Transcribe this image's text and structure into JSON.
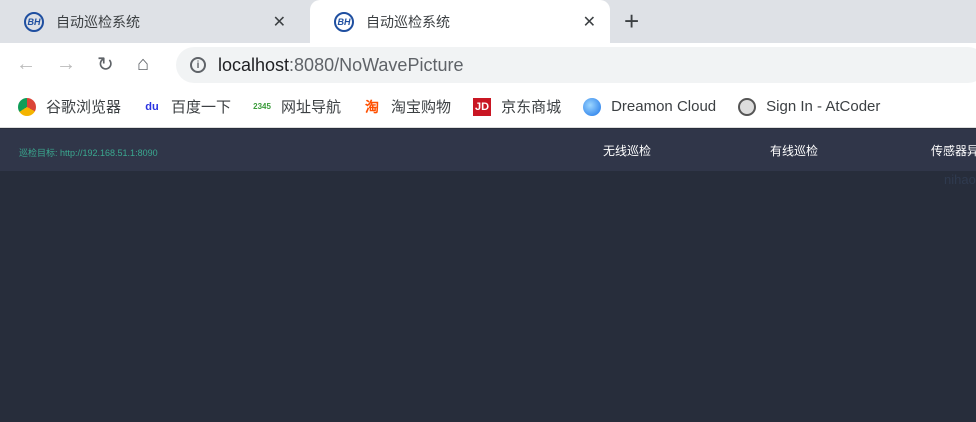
{
  "tabs": [
    {
      "title": "自动巡检系统",
      "close": "✕"
    },
    {
      "title": "自动巡检系统",
      "close": "✕"
    }
  ],
  "new_tab": "+",
  "address": {
    "host": "localhost",
    "path": ":8080/NoWavePicture"
  },
  "bookmarks": [
    {
      "label": "谷歌浏览器",
      "icon": "chrome-icon"
    },
    {
      "label": "百度一下",
      "icon": "baidu-icon"
    },
    {
      "label": "网址导航",
      "icon": "2345-icon"
    },
    {
      "label": "淘宝购物",
      "icon": "taobao-icon"
    },
    {
      "label": "京东商城",
      "icon": "jd-icon"
    },
    {
      "label": "Dreamon Cloud",
      "icon": "dreamon-icon"
    },
    {
      "label": "Sign In - AtCoder",
      "icon": "atcoder-icon"
    }
  ],
  "app": {
    "target": "巡检目标: http://192.168.51.1:8090",
    "menu": [
      "无线巡检",
      "有线巡检",
      "传感器异"
    ],
    "extra": "nihao"
  }
}
